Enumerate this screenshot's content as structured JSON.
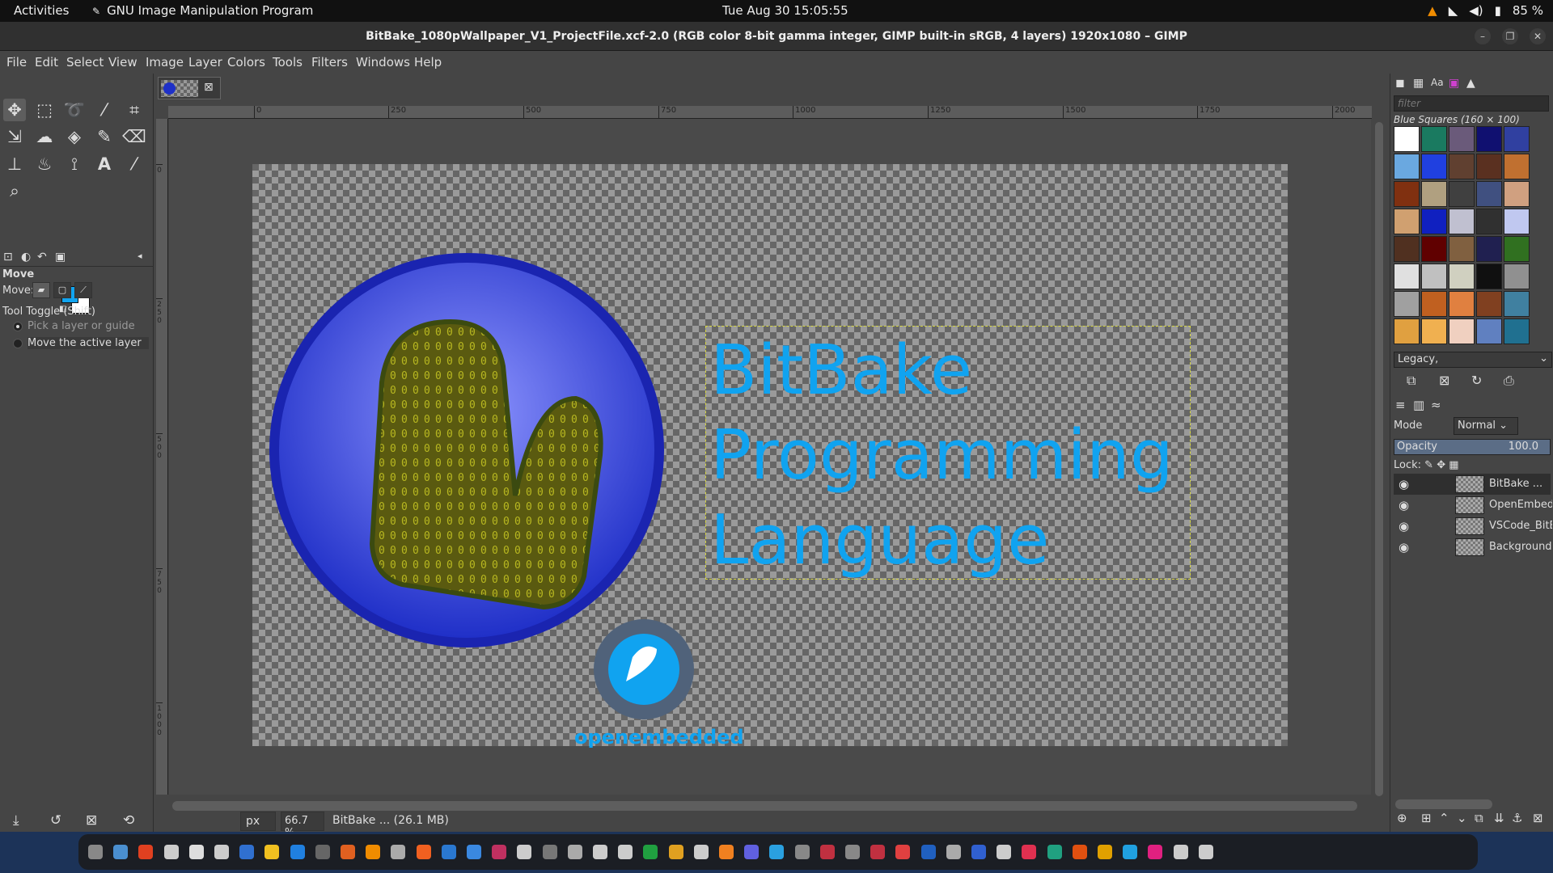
{
  "topbar": {
    "activities": "Activities",
    "app_name": "GNU Image Manipulation Program",
    "clock": "Tue Aug 30  15:05:55",
    "battery": "85 %"
  },
  "window": {
    "title": "BitBake_1080pWallpaper_V1_ProjectFile.xcf-2.0 (RGB color 8-bit gamma integer, GIMP built-in sRGB, 4 layers) 1920x1080 – GIMP"
  },
  "menu": [
    "File",
    "Edit",
    "Select",
    "View",
    "Image",
    "Layer",
    "Colors",
    "Tools",
    "Filters",
    "Windows",
    "Help"
  ],
  "colors": {
    "fg": "#11a4f0",
    "bg": "#ffffff",
    "accent": "#10a3f0"
  },
  "tool_options": {
    "title": "Move",
    "move_label": "Move:",
    "toggle_label": "Tool Toggle  (Shift)",
    "opt1": "Pick a layer or guide",
    "opt2": "Move the active layer"
  },
  "rulers": {
    "h": [
      "0",
      "250",
      "500",
      "750",
      "1000",
      "1250",
      "1500",
      "1750",
      "2000"
    ],
    "v": [
      "0",
      "250",
      "500",
      "750",
      "1000"
    ]
  },
  "canvas": {
    "text_line1": "BitBake",
    "text_line2": "Programming",
    "text_line3": "Language",
    "oe_logo_text": "openembedded"
  },
  "status": {
    "unit": "px",
    "zoom": "66.7 %",
    "info": "BitBake ... (26.1 MB)"
  },
  "patterns": {
    "filter_placeholder": "filter",
    "name": "Blue Squares (160 × 100)",
    "tag": "Legacy,"
  },
  "layers_panel": {
    "mode_label": "Mode",
    "mode_value": "Normal",
    "opacity_label": "Opacity",
    "opacity_value": "100.0",
    "lock_label": "Lock:",
    "layers": [
      {
        "name": "BitBake ..."
      },
      {
        "name": "OpenEmbedded"
      },
      {
        "name": "VSCode_BitBake"
      },
      {
        "name": "Background"
      }
    ]
  }
}
